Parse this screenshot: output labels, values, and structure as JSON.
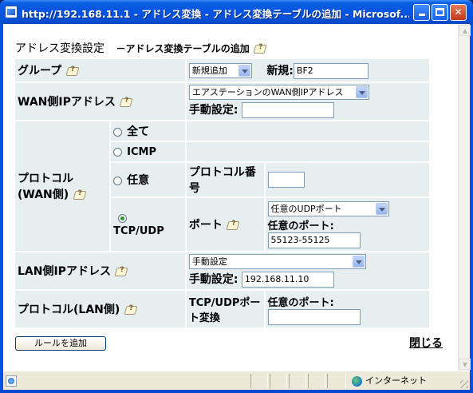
{
  "window": {
    "title": "http://192.168.11.1 - アドレス変換 - アドレス変換テーブルの追加 - Microsof...",
    "accent": "#0054e3"
  },
  "page": {
    "heading": "アドレス変換設定",
    "subheading": "－アドレス変換テーブルの追加"
  },
  "form": {
    "group": {
      "label": "グループ",
      "select_value": "新規追加",
      "new_label": "新規:",
      "new_value": "BF2"
    },
    "wan_ip": {
      "label": "WAN側IPアドレス",
      "select_value": "エアステーションのWAN側IPアドレス",
      "manual_label": "手動設定:",
      "manual_value": ""
    },
    "wan_protocol": {
      "label": "プロトコル(WAN側)",
      "options": {
        "all": "全て",
        "icmp": "ICMP",
        "any": "任意",
        "tcpudp": "TCP/UDP"
      },
      "selected": "TCP/UDP",
      "protocol_number_label": "プロトコル番号",
      "protocol_number_value": "",
      "port_label": "ポート",
      "port_select_value": "任意のUDPポート",
      "any_port_label": "任意のポート:",
      "any_port_value": "55123-55125"
    },
    "lan_ip": {
      "label": "LAN側IPアドレス",
      "select_value": "手動設定",
      "manual_label": "手動設定:",
      "manual_value": "192.168.11.10"
    },
    "lan_protocol": {
      "label": "プロトコル(LAN側)",
      "conv_label": "TCP/UDPポート変換",
      "any_port_label": "任意のポート:",
      "any_port_value": ""
    }
  },
  "actions": {
    "add_rule": "ルールを追加",
    "close": "閉じる"
  },
  "status": {
    "zone": "インターネット"
  }
}
